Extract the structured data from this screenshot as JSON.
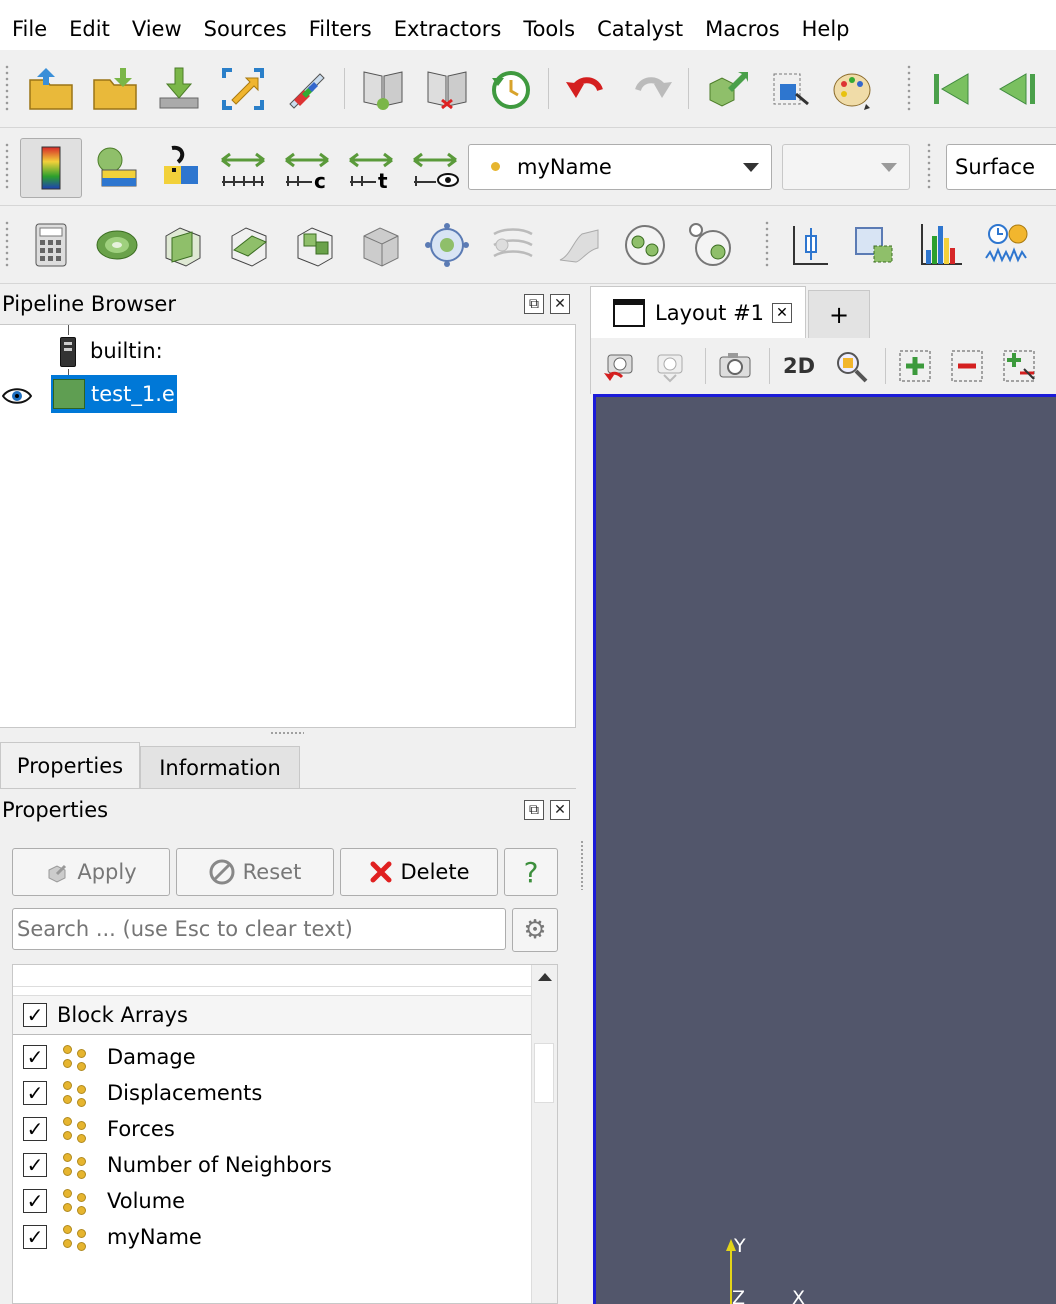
{
  "menu": [
    "File",
    "Edit",
    "View",
    "Sources",
    "Filters",
    "Extractors",
    "Tools",
    "Catalyst",
    "Macros",
    "Help"
  ],
  "toolbar2": {
    "color_by_value": "myName",
    "component_value": "",
    "representation_value": "Surface"
  },
  "pipeline_browser": {
    "title": "Pipeline Browser",
    "items": [
      {
        "label": "builtin:",
        "selected": false
      },
      {
        "label": "test_1.e",
        "selected": true
      }
    ]
  },
  "tabs": {
    "properties": "Properties",
    "information": "Information"
  },
  "properties_panel": {
    "title": "Properties",
    "apply_label": "Apply",
    "reset_label": "Reset",
    "delete_label": "Delete",
    "help_label": "?",
    "search_placeholder": "Search ... (use Esc to clear text)",
    "header_label": "Block Arrays",
    "arrays": [
      {
        "label": "Damage",
        "checked": true
      },
      {
        "label": "Displacements",
        "checked": true
      },
      {
        "label": "Forces",
        "checked": true
      },
      {
        "label": "Number of Neighbors",
        "checked": true
      },
      {
        "label": "Volume",
        "checked": true
      },
      {
        "label": "myName",
        "checked": true
      }
    ]
  },
  "layout": {
    "tab_label": "Layout #1",
    "add_tab_label": "+",
    "view_2d_label": "2D"
  },
  "axes": {
    "y": "Y",
    "z": "Z",
    "x": "X"
  },
  "colors": {
    "accent": "#0078d7",
    "render_background": "#52566b",
    "active_view_border": "#1b1bd9"
  }
}
